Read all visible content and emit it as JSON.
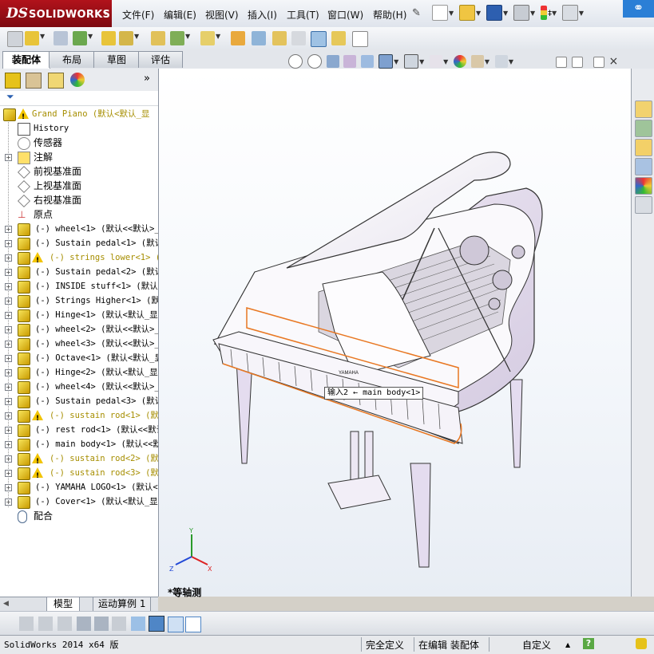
{
  "app": {
    "logo_prefix": "DS",
    "logo_name": "SOLIDWORKS",
    "logo_menu_arrow": "▸"
  },
  "menu": [
    "文件(F)",
    "编辑(E)",
    "视图(V)",
    "插入(I)",
    "工具(T)",
    "窗口(W)",
    "帮助(H)"
  ],
  "tabs": [
    "装配体",
    "布局",
    "草图",
    "评估"
  ],
  "tree": {
    "filter_icon": "funnel-icon",
    "panel_more": "»",
    "items": [
      {
        "label": "Grand Piano  (默认<默认_显",
        "icon": "assembly-icon",
        "warn": true,
        "expand": false,
        "plain": false
      },
      {
        "label": "History",
        "icon": "history-icon",
        "warn": false,
        "expand": false,
        "plain": false
      },
      {
        "label": "传感器",
        "icon": "sensor-icon",
        "warn": false,
        "expand": false,
        "plain": true
      },
      {
        "label": "注解",
        "icon": "annotation-icon",
        "warn": false,
        "expand": true,
        "plain": true
      },
      {
        "label": "前视基准面",
        "icon": "plane-icon",
        "warn": false,
        "expand": false,
        "plain": true
      },
      {
        "label": "上视基准面",
        "icon": "plane-icon",
        "warn": false,
        "expand": false,
        "plain": true
      },
      {
        "label": "右视基准面",
        "icon": "plane-icon",
        "warn": false,
        "expand": false,
        "plain": true
      },
      {
        "label": "原点",
        "icon": "origin-icon",
        "warn": false,
        "expand": false,
        "plain": true
      },
      {
        "label": "(-) wheel<1> (默认<<默认>_",
        "icon": "part-icon",
        "warn": false,
        "expand": true,
        "plain": false
      },
      {
        "label": "(-) Sustain pedal<1> (默认",
        "icon": "part-icon",
        "warn": false,
        "expand": true,
        "plain": false
      },
      {
        "label": "(-) strings lower<1> (",
        "icon": "part-icon",
        "warn": true,
        "expand": true,
        "plain": false
      },
      {
        "label": "(-) Sustain pedal<2> (默认",
        "icon": "part-icon",
        "warn": false,
        "expand": true,
        "plain": false
      },
      {
        "label": "(-) INSIDE stuff<1> (默认",
        "icon": "part-icon",
        "warn": false,
        "expand": true,
        "plain": false
      },
      {
        "label": "(-) Strings Higher<1> (默",
        "icon": "part-icon",
        "warn": false,
        "expand": true,
        "plain": false
      },
      {
        "label": "(-) Hinge<1> (默认<默认_显",
        "icon": "part-icon",
        "warn": false,
        "expand": true,
        "plain": false
      },
      {
        "label": "(-) wheel<2> (默认<<默认>_",
        "icon": "part-icon",
        "warn": false,
        "expand": true,
        "plain": false
      },
      {
        "label": "(-) wheel<3> (默认<<默认>_",
        "icon": "part-icon",
        "warn": false,
        "expand": true,
        "plain": false
      },
      {
        "label": "(-) Octave<1> (默认<默认_显",
        "icon": "part-icon",
        "warn": false,
        "expand": true,
        "plain": false
      },
      {
        "label": "(-) Hinge<2> (默认<默认_显",
        "icon": "part-icon",
        "warn": false,
        "expand": true,
        "plain": false
      },
      {
        "label": "(-) wheel<4> (默认<<默认>_",
        "icon": "part-icon",
        "warn": false,
        "expand": true,
        "plain": false
      },
      {
        "label": "(-) Sustain pedal<3> (默认",
        "icon": "part-icon",
        "warn": false,
        "expand": true,
        "plain": false
      },
      {
        "label": "(-) sustain rod<1> (默认",
        "icon": "part-icon",
        "warn": true,
        "expand": true,
        "plain": false
      },
      {
        "label": "(-) rest rod<1> (默认<<默认",
        "icon": "part-icon",
        "warn": false,
        "expand": true,
        "plain": false
      },
      {
        "label": "(-) main body<1> (默认<<默",
        "icon": "part-icon",
        "warn": false,
        "expand": true,
        "plain": false
      },
      {
        "label": "(-) sustain rod<2> (默认",
        "icon": "part-icon",
        "warn": true,
        "expand": true,
        "plain": false
      },
      {
        "label": "(-) sustain rod<3> (默认",
        "icon": "part-icon",
        "warn": true,
        "expand": true,
        "plain": false
      },
      {
        "label": "(-) YAMAHA LOGO<1> (默认<",
        "icon": "part-icon",
        "warn": false,
        "expand": true,
        "plain": false
      },
      {
        "label": "(-) Cover<1> (默认<默认_显",
        "icon": "part-icon",
        "warn": false,
        "expand": true,
        "plain": false
      },
      {
        "label": "配合",
        "icon": "mates-icon",
        "warn": false,
        "expand": false,
        "plain": true
      }
    ]
  },
  "bottom_tabs": [
    "模型",
    "运动算例 1"
  ],
  "graphics": {
    "view_label": "*等轴测",
    "tooltip": "输入2 ← main body<1>",
    "triad_x": "X",
    "triad_y": "Y",
    "triad_z": "Z",
    "brand_text": "YAMAHA"
  },
  "status": {
    "app_version": "SolidWorks 2014 x64 版",
    "definition": "完全定义",
    "editing": "在编辑 装配体",
    "units": "自定义",
    "help": "?"
  },
  "colors": {
    "logo_red": "#b1121b",
    "part_yellow": "#e6c21a",
    "warn_text": "#a68e00",
    "piano_lilac": "#e4dcef",
    "highlight_orange": "#e87722"
  }
}
